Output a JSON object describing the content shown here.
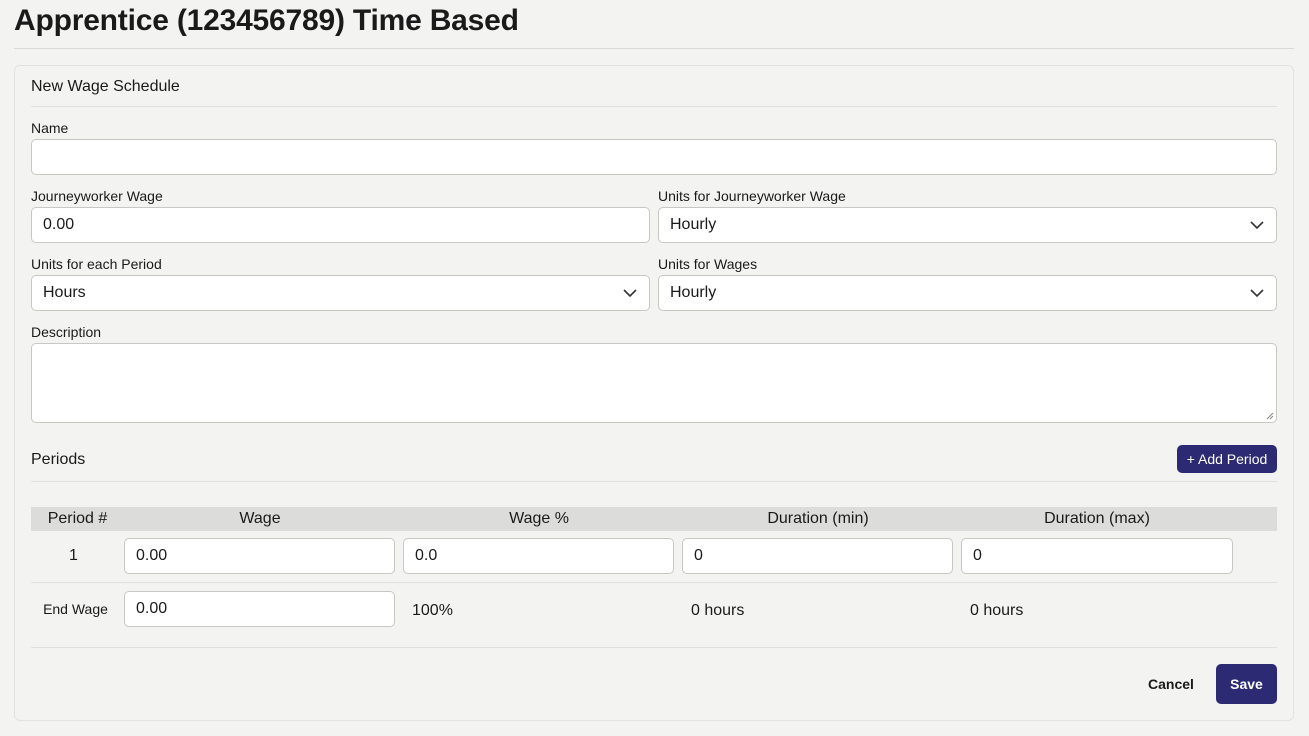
{
  "page": {
    "title": "Apprentice (123456789) Time Based"
  },
  "form": {
    "heading": "New Wage Schedule",
    "name": {
      "label": "Name",
      "value": ""
    },
    "journeyworker_wage": {
      "label": "Journeyworker Wage",
      "value": "0.00"
    },
    "units_journeyworker_wage": {
      "label": "Units for Journeyworker Wage",
      "value": "Hourly"
    },
    "units_each_period": {
      "label": "Units for each Period",
      "value": "Hours"
    },
    "units_wages": {
      "label": "Units for Wages",
      "value": "Hourly"
    },
    "description": {
      "label": "Description",
      "value": ""
    }
  },
  "periods": {
    "heading": "Periods",
    "add_button": "+ Add Period",
    "columns": [
      "Period #",
      "Wage",
      "Wage %",
      "Duration (min)",
      "Duration (max)"
    ],
    "rows": [
      {
        "number": "1",
        "wage": "0.00",
        "wage_pct": "0.0",
        "duration_min": "0",
        "duration_max": "0"
      }
    ],
    "end_wage": {
      "label": "End Wage",
      "wage": "0.00",
      "wage_pct": "100%",
      "duration_min": "0 hours",
      "duration_max": "0 hours"
    }
  },
  "actions": {
    "cancel": "Cancel",
    "save": "Save"
  },
  "colors": {
    "primary": "#2b2a73",
    "background": "#f3f3f2",
    "table_header": "#dcdcda"
  }
}
